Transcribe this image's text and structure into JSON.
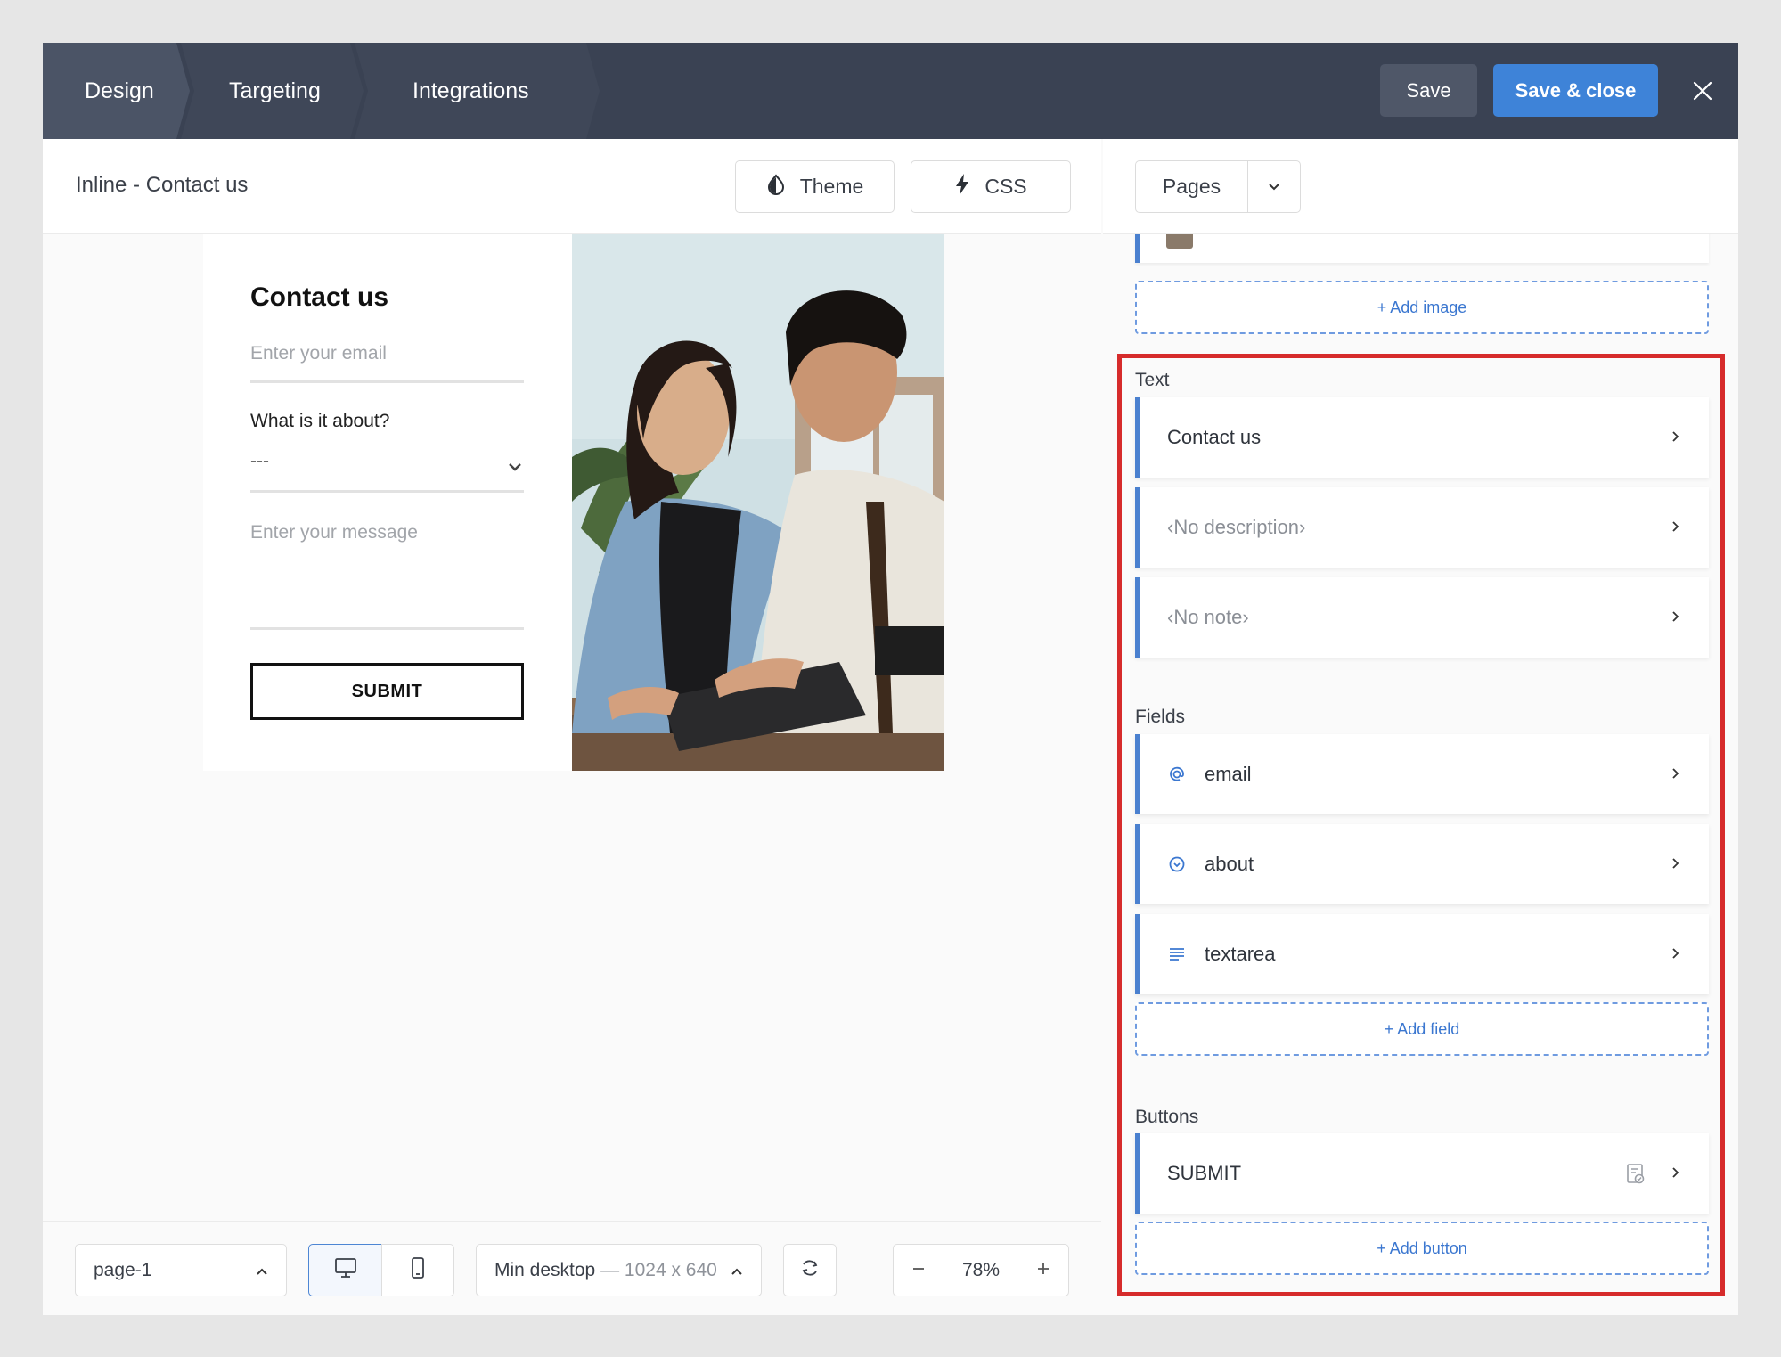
{
  "topbar": {
    "tabs": [
      {
        "label": "Design",
        "active": true
      },
      {
        "label": "Targeting",
        "active": false
      },
      {
        "label": "Integrations",
        "active": false
      }
    ],
    "save_label": "Save",
    "save_close_label": "Save & close",
    "accent_color": "#3e83d8"
  },
  "editor": {
    "page_name": "Inline - Contact us",
    "theme_label": "Theme",
    "css_label": "CSS"
  },
  "preview": {
    "title": "Contact us",
    "email_placeholder": "Enter your email",
    "about_label": "What is it about?",
    "about_value": "---",
    "message_placeholder": "Enter your message",
    "submit_label": "SUBMIT"
  },
  "footer": {
    "page_select": "page-1",
    "size_label": "Min desktop",
    "size_separator": "—",
    "size_dims": "1024 x 640",
    "zoom": "78%"
  },
  "sidebar": {
    "pages_label": "Pages",
    "add_image": "+ Add image",
    "text_section": "Text",
    "text_items": [
      {
        "label": "Contact us",
        "muted": false
      },
      {
        "label": "‹No description›",
        "muted": true
      },
      {
        "label": "‹No note›",
        "muted": true
      }
    ],
    "fields_section": "Fields",
    "field_items": [
      {
        "label": "email",
        "icon": "at-icon"
      },
      {
        "label": "about",
        "icon": "dropdown-circle-icon"
      },
      {
        "label": "textarea",
        "icon": "lines-icon"
      }
    ],
    "add_field": "+ Add field",
    "buttons_section": "Buttons",
    "button_items": [
      {
        "label": "SUBMIT"
      }
    ],
    "add_button": "+ Add button",
    "highlight_color": "#d62b2b"
  }
}
